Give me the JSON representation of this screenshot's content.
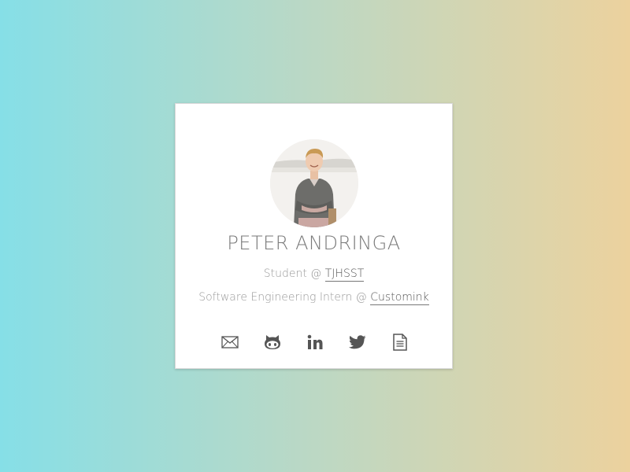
{
  "profile": {
    "name": "PETER ANDRINGA",
    "avatar_alt": "Peter Andringa"
  },
  "roles": [
    {
      "prefix": "Student @ ",
      "org": "TJHSST"
    },
    {
      "prefix": "Software Engineering Intern @ ",
      "org": "Customink"
    }
  ],
  "social": [
    {
      "name": "email",
      "icon": "mail-icon"
    },
    {
      "name": "github",
      "icon": "github-icon"
    },
    {
      "name": "linkedin",
      "icon": "linkedin-icon"
    },
    {
      "name": "twitter",
      "icon": "twitter-icon"
    },
    {
      "name": "resume",
      "icon": "document-icon"
    }
  ],
  "colors": {
    "gradient_start": "#86dfe7",
    "gradient_end": "#ecd29e",
    "icon": "#555555",
    "text_light": "#9a9a9a",
    "name_text": "#7a7a7a"
  }
}
